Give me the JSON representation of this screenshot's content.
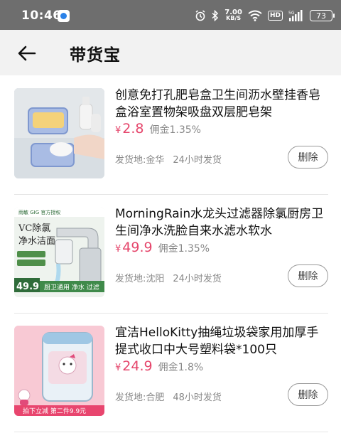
{
  "status_bar": {
    "time": "10:46",
    "net_speed_value": "7.00",
    "net_speed_unit": "KB/S",
    "hd_badge": "HD",
    "battery_level": "73",
    "signal_label": "5G"
  },
  "header": {
    "title": "带货宝"
  },
  "products": [
    {
      "title": "创意免打孔肥皂盒卫生间沥水壁挂香皂盒浴室置物架吸盘双层肥皂架",
      "price_symbol": "¥",
      "price": "2.8",
      "commission": "佣金1.35%",
      "ship_from": "发货地:金华",
      "ship_time": "24小时发货",
      "delete_label": "删除"
    },
    {
      "title": "MorningRain水龙头过滤器除氯厨房卫生间净水洗脸自来水滤水软水",
      "price_symbol": "¥",
      "price": "49.9",
      "commission": "佣金1.35%",
      "ship_from": "发货地:沈阳",
      "ship_time": "24小时发货",
      "delete_label": "删除",
      "image_text": {
        "brand": "雨敏 GIG 官方授权",
        "headline1": "VC除氯",
        "headline2": "净水洁面",
        "price_tag": "49.9",
        "tags": "厨卫通用 净水 过滤"
      }
    },
    {
      "title": "宜洁HelloKitty抽绳垃圾袋家用加厚手提式收口中大号塑料袋*100只",
      "price_symbol": "¥",
      "price": "24.9",
      "commission": "佣金1.8%",
      "ship_from": "发货地:合肥",
      "ship_time": "48小时发货",
      "delete_label": "删除",
      "image_text": {
        "banner": "拍下立减 第二件9.9元"
      }
    }
  ],
  "colors": {
    "price": "#e5456b",
    "status_bar_bg": "#6e6e6e",
    "header_bg": "#f2f2f2"
  }
}
